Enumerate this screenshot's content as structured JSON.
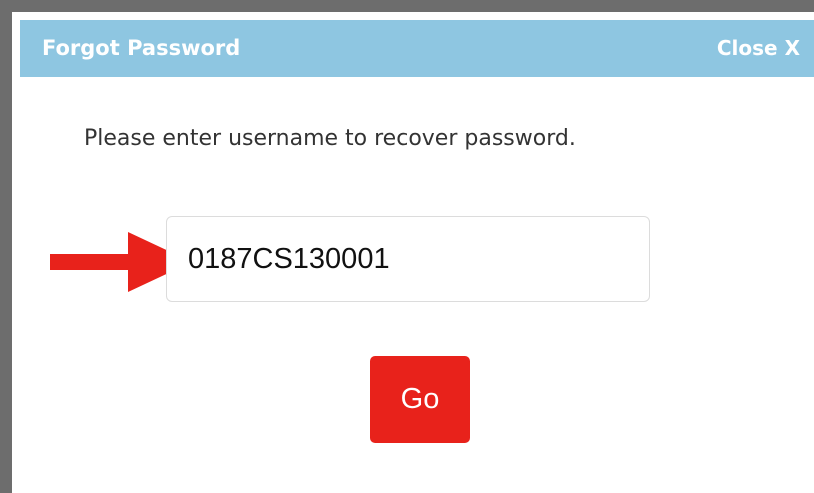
{
  "dialog": {
    "title": "Forgot Password",
    "close_label": "Close X",
    "instructions": "Please enter username to recover password.",
    "username_value": "0187CS130001",
    "go_label": "Go"
  },
  "colors": {
    "header": "#8ec6e1",
    "button": "#e8221b",
    "arrow": "#e8221b",
    "frame": "#6d6d6d"
  },
  "icons": {
    "pointer": "red-arrow-icon"
  }
}
